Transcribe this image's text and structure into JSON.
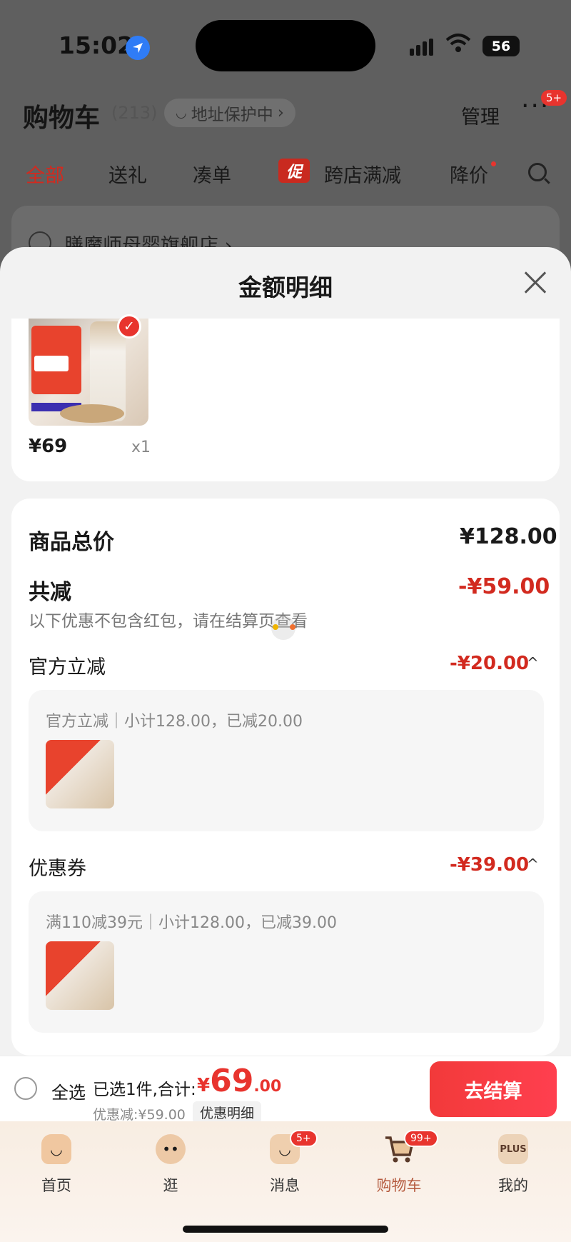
{
  "status_bar": {
    "time": "15:02",
    "battery": "56"
  },
  "header": {
    "title": "购物车",
    "count": "(213)",
    "address_protect": "地址保护中",
    "address_chevron": "›",
    "manage": "管理",
    "more": "···",
    "more_badge": "5+"
  },
  "tabs": {
    "all": "全部",
    "gift": "送礼",
    "bundle": "凑单",
    "promo_icon": "促",
    "cross_store": "跨店满减",
    "price_drop": "降价"
  },
  "store": {
    "name": "膳魔师母婴旗舰店 ›"
  },
  "sheet": {
    "title": "金额明细",
    "item": {
      "price": "¥69",
      "qty": "x1"
    },
    "total_label": "商品总价",
    "total_value": "¥128.00",
    "reduce_label": "共减",
    "reduce_value": "-¥59.00",
    "note": "以下优惠不包含红包，请在结算页查看",
    "official": {
      "label": "官方立减",
      "value": "-¥20.00",
      "chevron": "^",
      "detail": "官方立减｜小计128.00，已减20.00"
    },
    "coupon": {
      "label": "优惠券",
      "value": "-¥39.00",
      "chevron": "^",
      "detail": "满110减39元｜小计128.00，已减39.00"
    }
  },
  "bottom_bar": {
    "select_all": "全选",
    "selected_text": "已选1件,合计:",
    "total_symbol": "¥",
    "total_int": "69",
    "total_dec": ".00",
    "discount_text": "优惠减:¥59.00",
    "detail_button": "优惠明细",
    "checkout": "去结算"
  },
  "tabbar": {
    "items": [
      {
        "label": "首页",
        "icon": "home-icon"
      },
      {
        "label": "逛",
        "icon": "browse-icon"
      },
      {
        "label": "消息",
        "icon": "message-icon",
        "badge": "5+"
      },
      {
        "label": "购物车",
        "icon": "cart-icon",
        "badge": "99+"
      },
      {
        "label": "我的",
        "icon": "plus-icon",
        "icon_text": "PLUS"
      }
    ]
  },
  "colors": {
    "accent": "#e8342e",
    "price_red": "#d22a1f",
    "checkout": "#f23a3a"
  }
}
